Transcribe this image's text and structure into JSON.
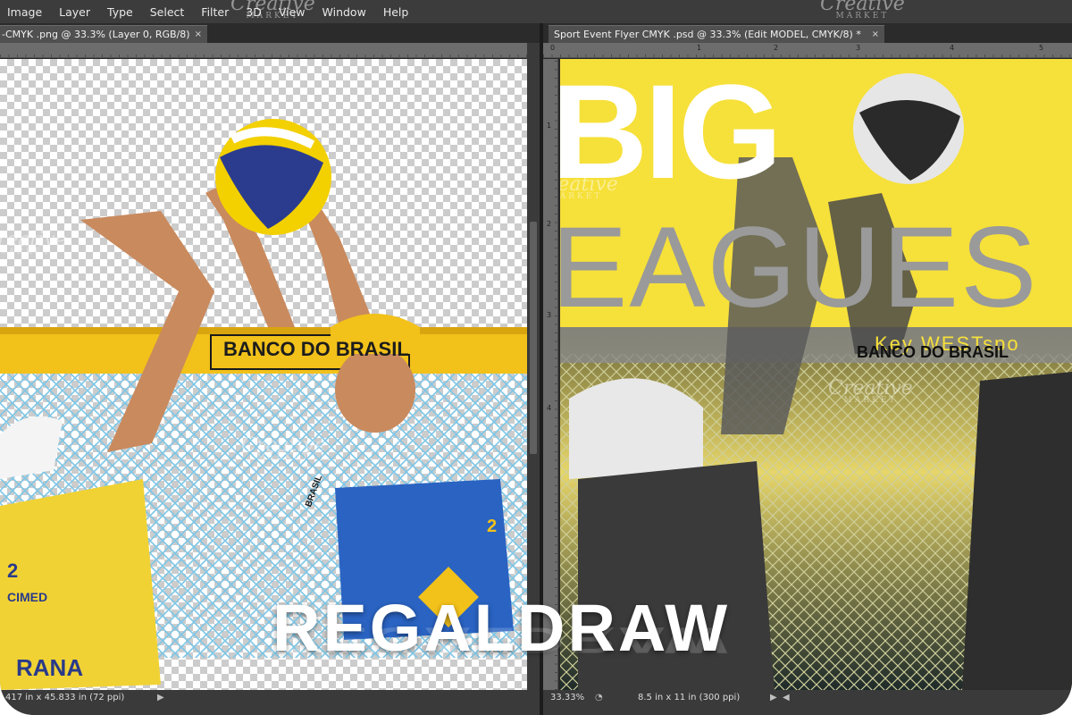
{
  "menu": [
    "Image",
    "Layer",
    "Type",
    "Select",
    "Filter",
    "3D",
    "View",
    "Window",
    "Help"
  ],
  "tabs": {
    "left": "-CMYK .png @ 33.3% (Layer 0, RGB/8)",
    "right": "Sport Event Flyer CMYK .psd @ 33.3% (Edit MODEL, CMYK/8) *",
    "close_glyph": "×"
  },
  "rulers": {
    "right_h": [
      "0",
      "1",
      "2",
      "3",
      "4",
      "5"
    ],
    "right_v": [
      "1",
      "2",
      "3",
      "4"
    ]
  },
  "left_doc": {
    "sponsor": "BANCO DO BRASIL",
    "jersey_left": "RANA",
    "jersey_left_top": "CIMED",
    "number": "2",
    "wrist": "BRASIL",
    "status": "417 in x 45.833 in (72 ppi)"
  },
  "right_doc": {
    "headline_big": "BIG",
    "headline_leagues": "EAGUES",
    "subhead": "Key WESTspo",
    "sponsor": "BANCO DO BRASIL",
    "zoom": "33.33%",
    "status": "8.5 in x 11 in (300 ppi)"
  },
  "watermark": {
    "brand": "REGALDRAW",
    "marketplace": "Creative",
    "marketplace_sub": "MARKET"
  },
  "colors": {
    "flyer_yellow": "#f6e03a",
    "net_blue": "#7ec6e6",
    "jersey_blue": "#2a63c2",
    "ball_blue": "#2b3c8f"
  }
}
